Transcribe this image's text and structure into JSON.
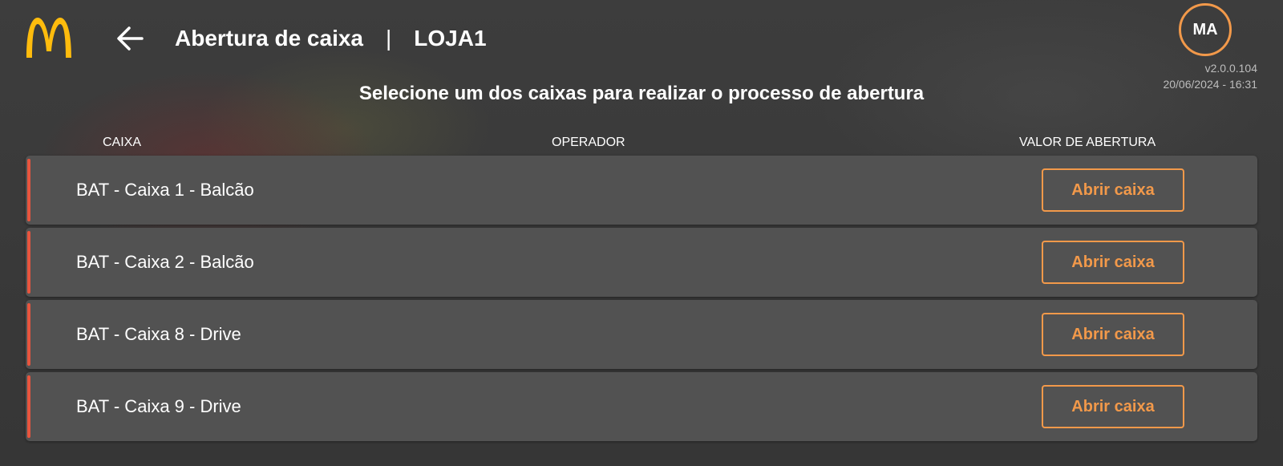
{
  "brand": {
    "logo_icon": "mcdonalds-arches-icon",
    "logo_color": "#FFBC0D"
  },
  "header": {
    "back_icon": "arrow-left-icon",
    "title": "Abertura de caixa",
    "separator": "|",
    "store": "LOJA1"
  },
  "user": {
    "initials": "MA",
    "version": "v2.0.0.104",
    "datetime": "20/06/2024 - 16:31"
  },
  "instruction": "Selecione um dos caixas para realizar o processo de abertura",
  "table": {
    "columns": [
      "CAIXA",
      "OPERADOR",
      "VALOR DE ABERTURA"
    ],
    "rows": [
      {
        "caixa": "BAT - Caixa 1 - Balcão",
        "operador": "",
        "action": "Abrir caixa"
      },
      {
        "caixa": "BAT - Caixa 2 - Balcão",
        "operador": "",
        "action": "Abrir caixa"
      },
      {
        "caixa": "BAT - Caixa 8 - Drive",
        "operador": "",
        "action": "Abrir caixa"
      },
      {
        "caixa": "BAT - Caixa 9 - Drive",
        "operador": "",
        "action": "Abrir caixa"
      }
    ]
  },
  "colors": {
    "accent": "#F2994A",
    "row_status": "#E8553E",
    "row_bg": "#525252",
    "background": "#3A3A3A"
  }
}
